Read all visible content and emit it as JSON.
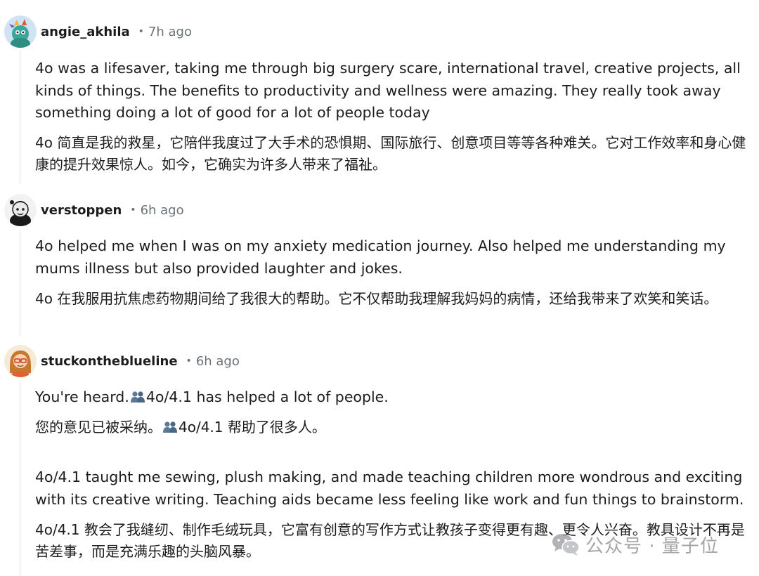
{
  "comments": [
    {
      "username": "angie_akhila",
      "separator": "•",
      "time": "7h ago",
      "avatar": "avatar-icon",
      "paragraphs": [
        "4o was a lifesaver, taking me through big surgery scare, international travel, creative projects, all kinds of things. The benefits to productivity and wellness were amazing. They really took away something doing a lot of good for a lot of people today",
        "4o 简直是我的救星，它陪伴我度过了大手术的恐惧期、国际旅行、创意项目等等各种难关。它对工作效率和身心健康的提升效果惊人。如今，它确实为许多人带来了福祉。"
      ]
    },
    {
      "username": "verstoppen",
      "separator": "•",
      "time": "6h ago",
      "avatar": "avatar-icon",
      "paragraphs": [
        "4o helped me when I was on my anxiety medication journey. Also helped me understanding my mums illness but also provided laughter and jokes.",
        "4o 在我服用抗焦虑药物期间给了我很大的帮助。它不仅帮助我理解我妈妈的病情，还给我带来了欢笑和笑话。"
      ]
    },
    {
      "username": "stuckontheblueline",
      "separator": "•",
      "time": "6h ago",
      "avatar": "avatar-icon",
      "paragraphs": [
        {
          "before": "You're heard.",
          "icon": "people-emoji-icon",
          "after": "4o/4.1 has helped a lot of people."
        },
        {
          "before": "您的意见已被采纳。",
          "icon": "people-emoji-icon",
          "after": "4o/4.1 帮助了很多人。"
        },
        "4o/4.1 taught me sewing, plush making, and made teaching children more wondrous and exciting with its creative writing. Teaching aids became less feeling like work and fun things to brainstorm.",
        "4o/4.1 教会了我缝纫、制作毛绒玩具，它富有创意的写作方式让教孩子变得更有趣、更令人兴奋。教具设计不再是苦差事，而是充满乐趣的头脑风暴。"
      ]
    }
  ],
  "watermark": {
    "icon": "wechat-icon",
    "text": "公众号 · 量子位"
  },
  "colors": {
    "text": "#1c1c1c",
    "meta": "#6b7378",
    "thread_line": "#dfe2e5",
    "emoji": "#5b7a9a"
  }
}
